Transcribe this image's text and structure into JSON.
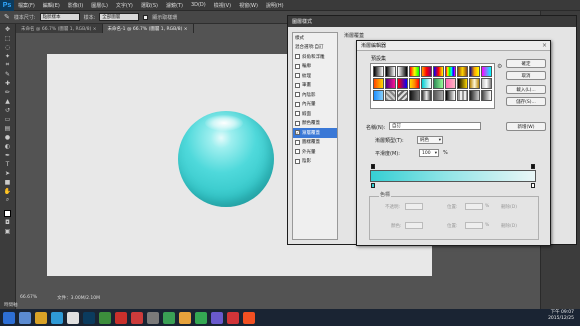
{
  "menubar": {
    "logo": "Ps",
    "items": [
      "檔案(F)",
      "編輯(E)",
      "影像(I)",
      "圖層(L)",
      "文字(Y)",
      "選取(S)",
      "濾鏡(T)",
      "3D(D)",
      "檢視(V)",
      "視窗(W)",
      "說明(H)"
    ]
  },
  "options": {
    "size_label": "樣本尺寸:",
    "size_value": "點狀樣本",
    "sample_label": "樣本:",
    "sample_value": "全部圖層",
    "ring_label": "顯示取樣環"
  },
  "tabs": [
    {
      "label": "未命名 @ 66.7% (圖層 1, RGB/8) ×"
    },
    {
      "label": "未命名-1 @ 66.7% (圖層 1, RGB/8) ×"
    }
  ],
  "status": {
    "zoom": "66.67%",
    "doc": "文件：3.00M/2.10M",
    "timeline": "時間軸"
  },
  "clock": {
    "time": "下午 09:07",
    "date": "2015/12/25"
  },
  "layer_style": {
    "title": "圖層樣式",
    "items": [
      {
        "label": "樣式",
        "check": false,
        "selected": false
      },
      {
        "label": "混合選項:自訂",
        "check": false,
        "selected": false
      },
      {
        "label": "斜角和浮雕",
        "check": true,
        "selected": false
      },
      {
        "label": "輪廓",
        "check": true,
        "selected": false
      },
      {
        "label": "紋理",
        "check": true,
        "selected": false
      },
      {
        "label": "筆畫",
        "check": true,
        "selected": false
      },
      {
        "label": "內陰影",
        "check": true,
        "selected": false
      },
      {
        "label": "內光暈",
        "check": true,
        "selected": false
      },
      {
        "label": "緞面",
        "check": true,
        "selected": false
      },
      {
        "label": "顏色覆蓋",
        "check": true,
        "selected": false
      },
      {
        "label": "漸層覆蓋",
        "check": true,
        "selected": true
      },
      {
        "label": "圖樣覆蓋",
        "check": true,
        "selected": false
      },
      {
        "label": "外光暈",
        "check": true,
        "selected": false
      },
      {
        "label": "陰影",
        "check": true,
        "selected": false
      }
    ],
    "section_title": "漸層覆蓋"
  },
  "gradient_editor": {
    "title": "漸層編輯器",
    "presets_label": "預設集",
    "buttons": {
      "ok": "確定",
      "cancel": "取消",
      "load": "載入(L)...",
      "save": "儲存(S)...",
      "new": "新增(W)"
    },
    "name_label": "名稱(N):",
    "name_value": "自訂",
    "type_label": "漸層類型(T):",
    "type_value": "純色",
    "smooth_label": "平滑度(M):",
    "smooth_value": "100",
    "smooth_unit": "%",
    "stops_label": "色標",
    "opacity_label": "不透明:",
    "color_label": "顏色:",
    "location_label": "位置:",
    "location_unit": "%",
    "delete_label": "刪除(D)"
  }
}
